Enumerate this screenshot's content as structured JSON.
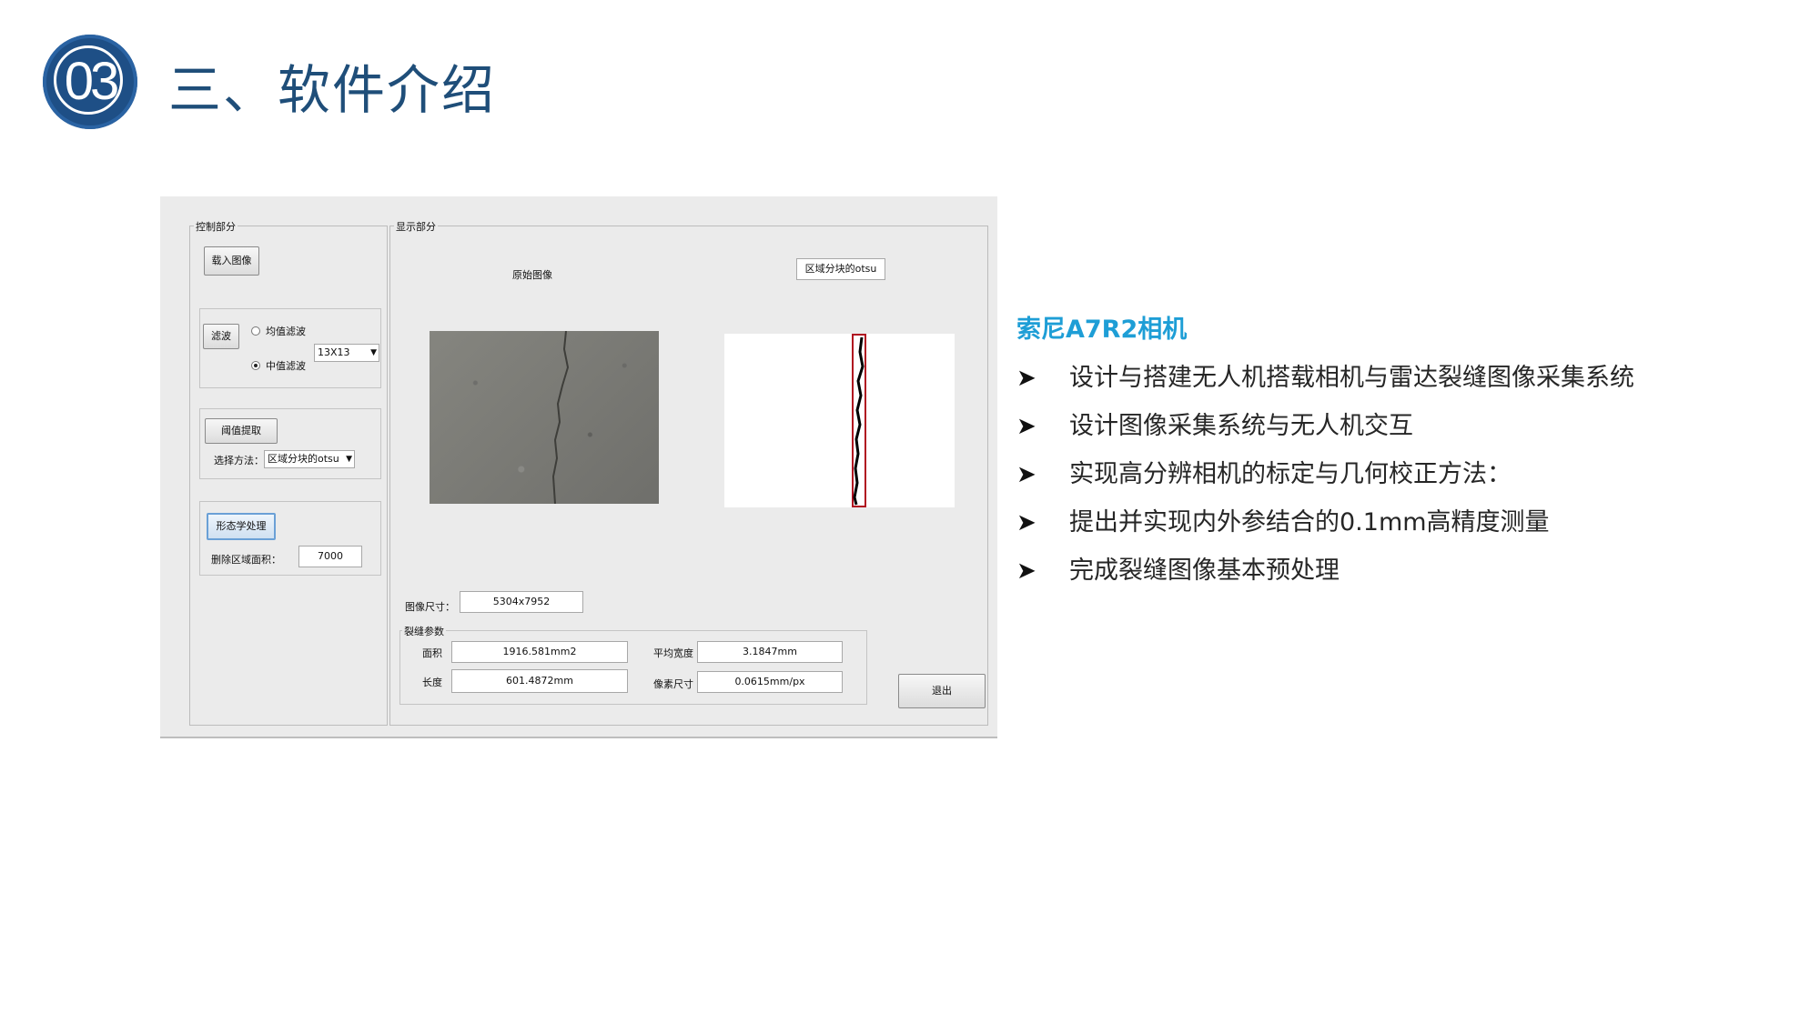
{
  "header": {
    "badge_number": "03",
    "title": "三、软件介绍",
    "badge_color": "#1e4f86",
    "title_color": "#1f4e79"
  },
  "app": {
    "control_group": {
      "title": "控制部分",
      "load_button": "载入图像",
      "filter_button": "滤波",
      "mean_filter": "均值滤波",
      "median_filter": "中值滤波",
      "filter_selected": "median",
      "kernel_size": "13X13",
      "threshold_button": "阈值提取",
      "method_label": "选择方法：",
      "method_value": "区域分块的otsu",
      "morph_button": "形态学处理",
      "remove_area_label": "删除区域面积：",
      "remove_area_value": "7000"
    },
    "display_group": {
      "title": "显示部分",
      "original_label": "原始图像",
      "result_label": "区域分块的otsu",
      "image_size_label": "图像尺寸：",
      "image_size_value": "5304x7952",
      "crack_params_title": "裂缝参数",
      "area_label": "面积",
      "area_value": "1916.581mm2",
      "length_label": "长度",
      "length_value": "601.4872mm",
      "avg_width_label": "平均宽度",
      "avg_width_value": "3.1847mm",
      "pixel_size_label": "像素尺寸",
      "pixel_size_value": "0.0615mm/px",
      "exit_button": "退出"
    }
  },
  "right": {
    "subtitle": "索尼A7R2相机",
    "subtitle_color": "#1e9ed6",
    "bullet_icon": "arrowhead-icon",
    "bullets": [
      "设计与搭建无人机搭载相机与雷达裂缝图像采集系统",
      "设计图像采集系统与无人机交互",
      "实现高分辨相机的标定与几何校正方法：",
      "提出并实现内外参结合的0.1mm高精度测量",
      "完成裂缝图像基本预处理"
    ]
  }
}
